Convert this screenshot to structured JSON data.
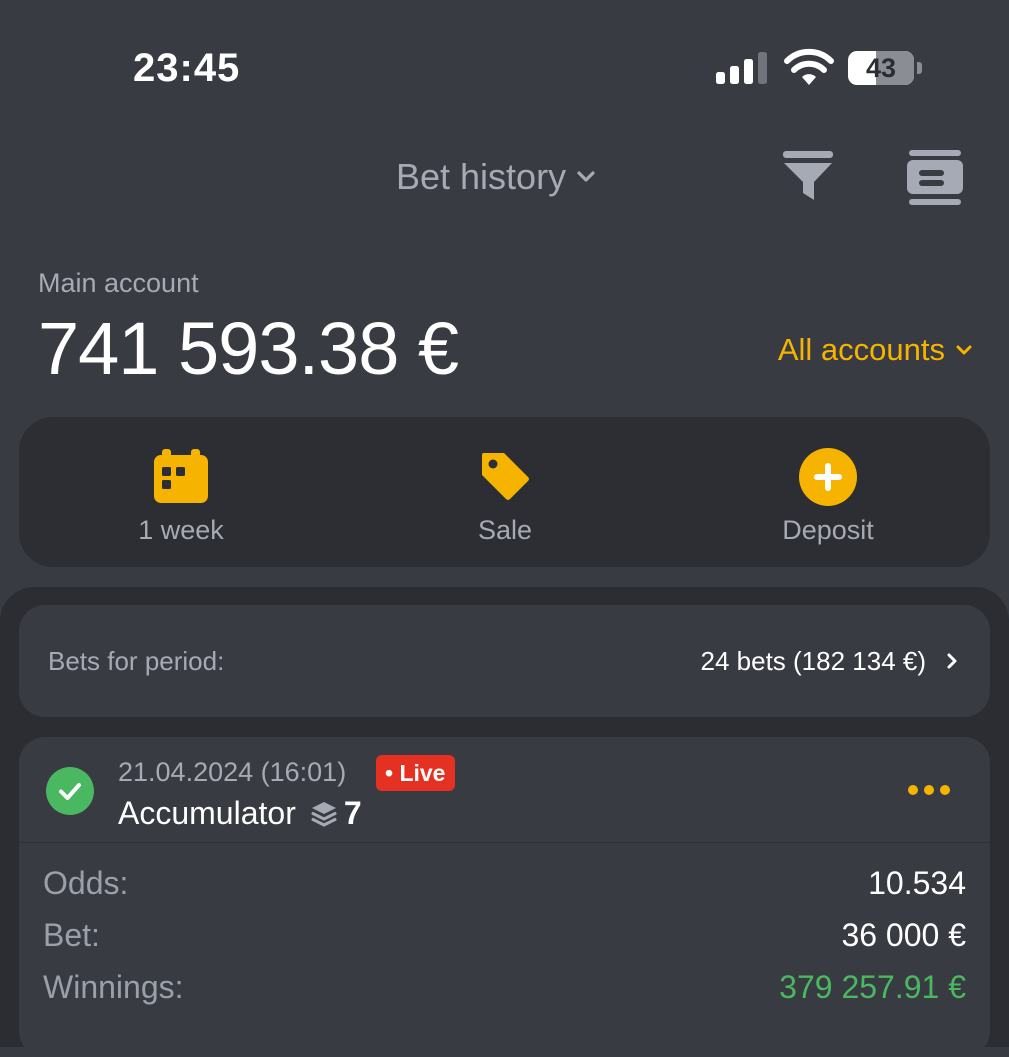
{
  "status_bar": {
    "time": "23:45",
    "battery": "43"
  },
  "header": {
    "title": "Bet history"
  },
  "account": {
    "label": "Main account",
    "balance": "741 593.38 €",
    "switcher": "All accounts"
  },
  "actions": [
    {
      "label": "1 week",
      "icon": "calendar-icon"
    },
    {
      "label": "Sale",
      "icon": "tag-icon"
    },
    {
      "label": "Deposit",
      "icon": "plus-circle-icon"
    }
  ],
  "period": {
    "label": "Bets for period:",
    "value": "24 bets (182 134 €)"
  },
  "bet": {
    "date": "21.04.2024 (16:01)",
    "badge": "• Live",
    "type": "Accumulator",
    "selections": "7",
    "rows": [
      {
        "label": "Odds:",
        "value": "10.534"
      },
      {
        "label": "Bet:",
        "value": "36 000 €"
      },
      {
        "label": "Winnings:",
        "value": "379 257.91 €"
      }
    ]
  },
  "colors": {
    "background": "#383b42",
    "sheet": "#2b2d33",
    "accent": "#f6b300",
    "win": "#4ab860",
    "live": "#e53122"
  }
}
